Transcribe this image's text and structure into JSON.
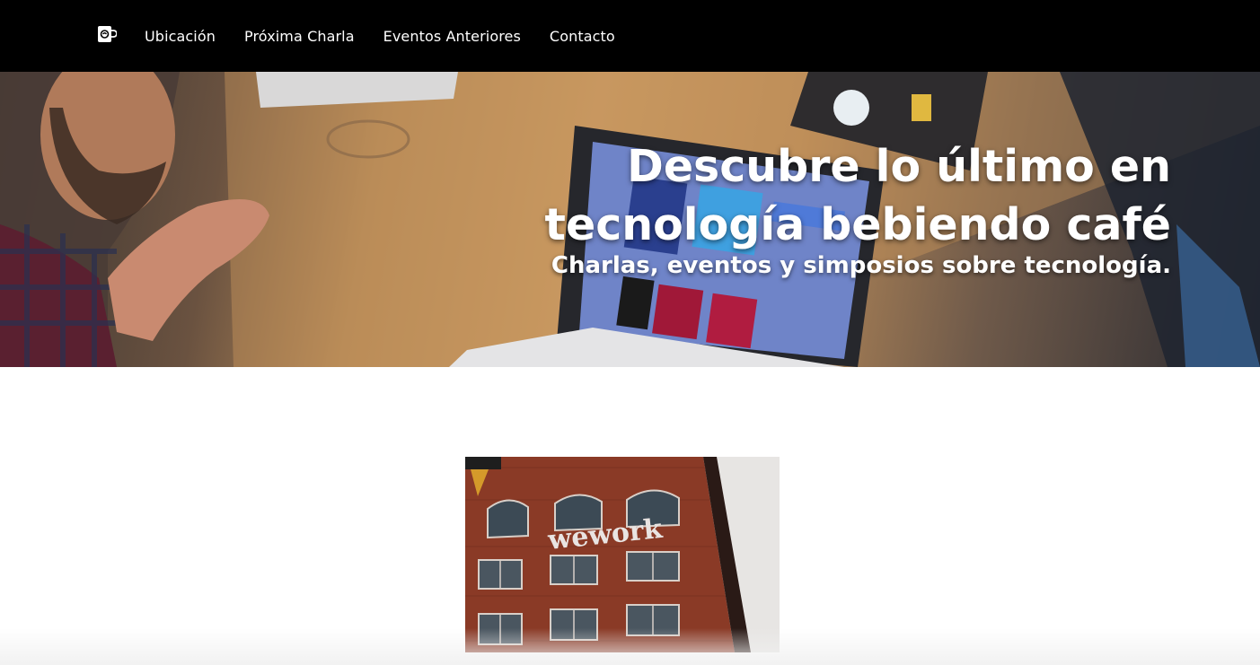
{
  "navbar": {
    "logo_icon": "coffee-cup-icon",
    "links": [
      {
        "label": "Ubicación"
      },
      {
        "label": "Próxima Charla"
      },
      {
        "label": "Eventos Anteriores"
      },
      {
        "label": "Contacto"
      }
    ]
  },
  "hero": {
    "title": "Descubre lo último en tecnología bebiendo café",
    "subtitle": "Charlas, eventos y simposios sobre tecnología."
  },
  "event_image": {
    "sign_text": "wework"
  },
  "colors": {
    "navbar_bg": "#000000",
    "nav_text": "#ffffff",
    "hero_text": "#ffffff",
    "brick": "#8a3a26"
  }
}
